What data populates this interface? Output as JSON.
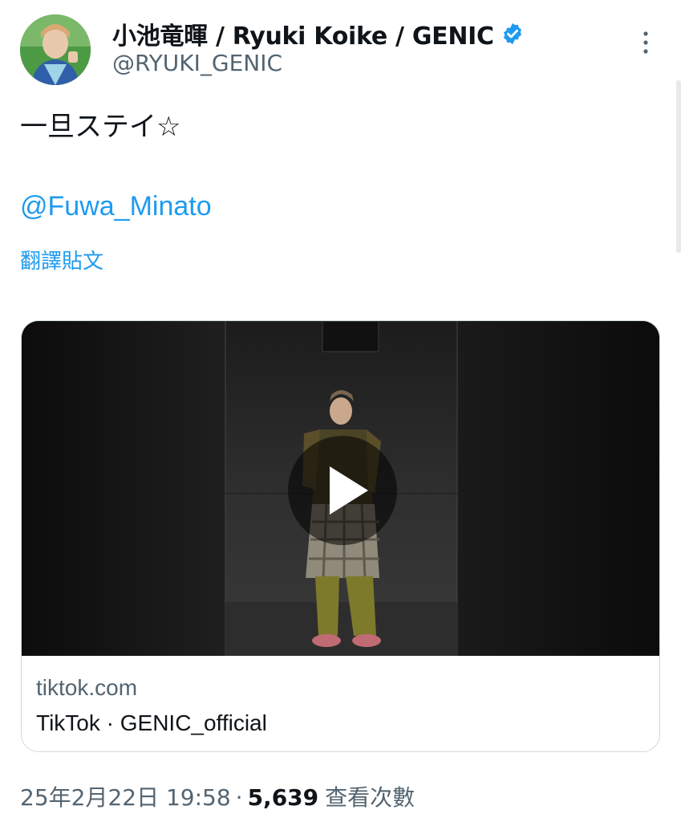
{
  "author": {
    "display_name": "小池竜暉 / Ryuki Koike / GENIC",
    "handle": "@RYUKI_GENIC",
    "verified": true
  },
  "tweet": {
    "text": "一旦ステイ☆",
    "mention": "@Fuwa_Minato",
    "translate_label": "翻譯貼文"
  },
  "card": {
    "domain": "tiktok.com",
    "title": "TikTok · GENIC_official"
  },
  "meta": {
    "timestamp": "25年2月22日 19:58",
    "separator": "·",
    "views_count": "5,639",
    "views_label": "查看次數"
  },
  "colors": {
    "accent": "#1d9bf0",
    "secondary_text": "#536471",
    "primary_text": "#0f1419",
    "border": "#cfd9de"
  },
  "icons": {
    "verified": "verified-badge-icon",
    "more": "more-options-icon",
    "play": "play-icon"
  }
}
